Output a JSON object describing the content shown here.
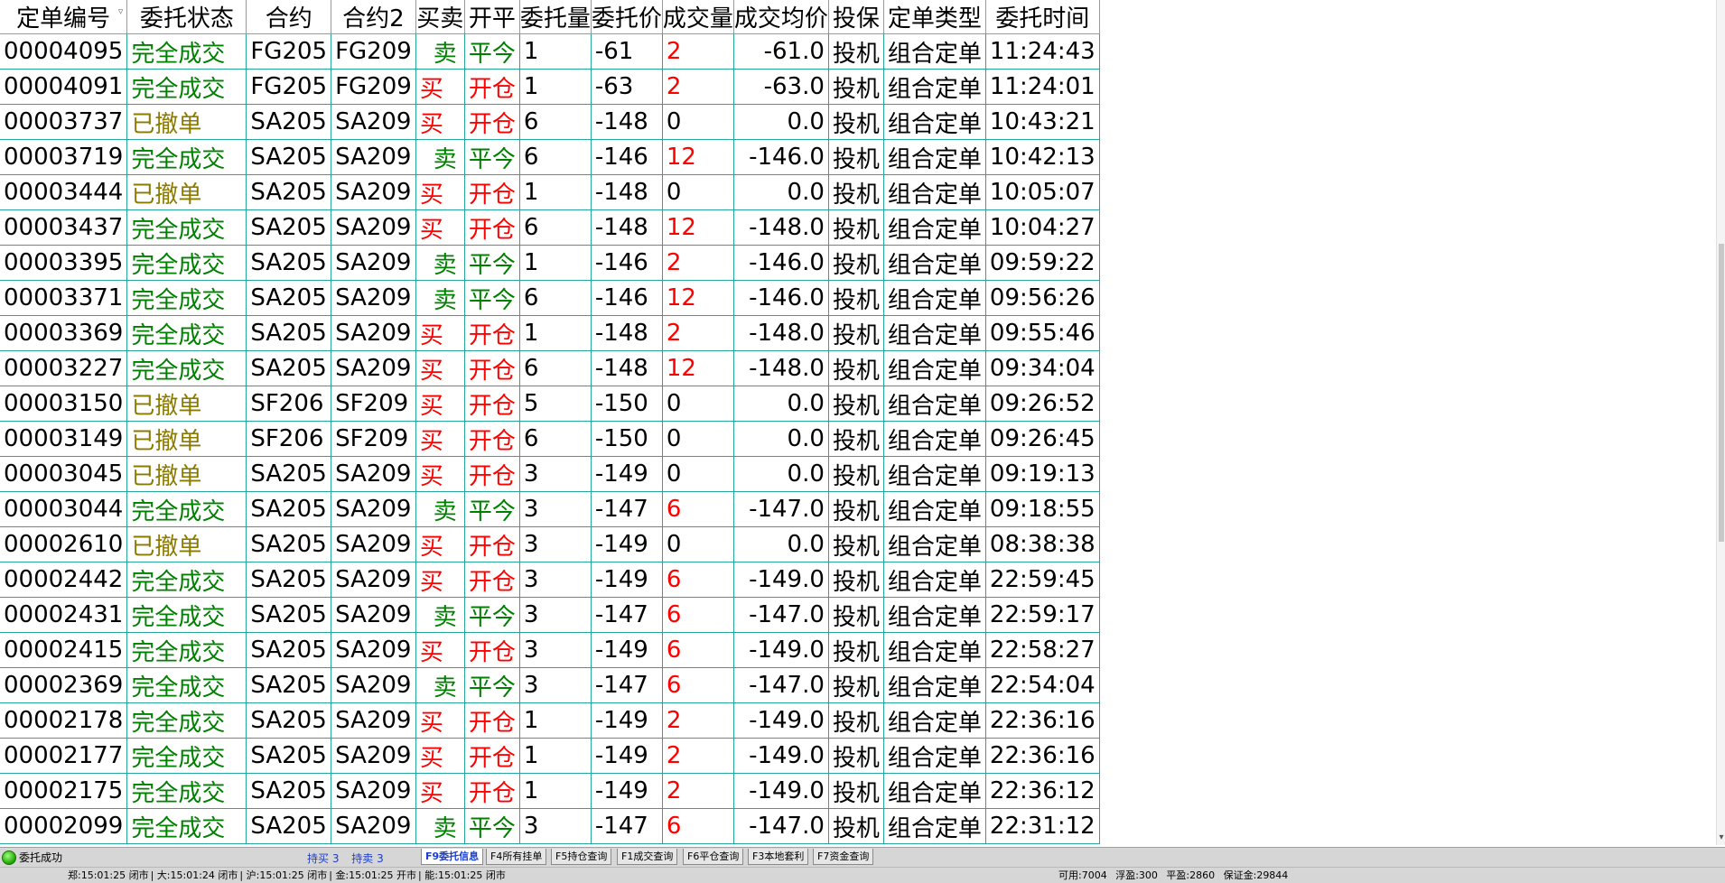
{
  "columns": [
    {
      "key": "id",
      "label": "定单编号"
    },
    {
      "key": "status",
      "label": "委托状态"
    },
    {
      "key": "contract",
      "label": "合约"
    },
    {
      "key": "contract2",
      "label": "合约2"
    },
    {
      "key": "side",
      "label": "买卖"
    },
    {
      "key": "oc",
      "label": "开平"
    },
    {
      "key": "qty",
      "label": "委托量"
    },
    {
      "key": "price",
      "label": "委托价"
    },
    {
      "key": "filled",
      "label": "成交量"
    },
    {
      "key": "avg",
      "label": "成交均价"
    },
    {
      "key": "hedge",
      "label": "投保"
    },
    {
      "key": "type",
      "label": "定单类型"
    },
    {
      "key": "time",
      "label": "委托时间"
    }
  ],
  "sort_indicator": "▿",
  "rows": [
    {
      "id": "00004095",
      "status": "完全成交",
      "contract": "FG205",
      "contract2": "FG209",
      "side": "卖",
      "oc": "平今",
      "qty": "1",
      "price": "-61",
      "filled": "2",
      "avg": "-61.0",
      "hedge": "投机",
      "type": "组合定单",
      "time": "11:24:43"
    },
    {
      "id": "00004091",
      "status": "完全成交",
      "contract": "FG205",
      "contract2": "FG209",
      "side": "买",
      "oc": "开仓",
      "qty": "1",
      "price": "-63",
      "filled": "2",
      "avg": "-63.0",
      "hedge": "投机",
      "type": "组合定单",
      "time": "11:24:01"
    },
    {
      "id": "00003737",
      "status": "已撤单",
      "contract": "SA205",
      "contract2": "SA209",
      "side": "买",
      "oc": "开仓",
      "qty": "6",
      "price": "-148",
      "filled": "0",
      "avg": "0.0",
      "hedge": "投机",
      "type": "组合定单",
      "time": "10:43:21"
    },
    {
      "id": "00003719",
      "status": "完全成交",
      "contract": "SA205",
      "contract2": "SA209",
      "side": "卖",
      "oc": "平今",
      "qty": "6",
      "price": "-146",
      "filled": "12",
      "avg": "-146.0",
      "hedge": "投机",
      "type": "组合定单",
      "time": "10:42:13"
    },
    {
      "id": "00003444",
      "status": "已撤单",
      "contract": "SA205",
      "contract2": "SA209",
      "side": "买",
      "oc": "开仓",
      "qty": "1",
      "price": "-148",
      "filled": "0",
      "avg": "0.0",
      "hedge": "投机",
      "type": "组合定单",
      "time": "10:05:07"
    },
    {
      "id": "00003437",
      "status": "完全成交",
      "contract": "SA205",
      "contract2": "SA209",
      "side": "买",
      "oc": "开仓",
      "qty": "6",
      "price": "-148",
      "filled": "12",
      "avg": "-148.0",
      "hedge": "投机",
      "type": "组合定单",
      "time": "10:04:27"
    },
    {
      "id": "00003395",
      "status": "完全成交",
      "contract": "SA205",
      "contract2": "SA209",
      "side": "卖",
      "oc": "平今",
      "qty": "1",
      "price": "-146",
      "filled": "2",
      "avg": "-146.0",
      "hedge": "投机",
      "type": "组合定单",
      "time": "09:59:22"
    },
    {
      "id": "00003371",
      "status": "完全成交",
      "contract": "SA205",
      "contract2": "SA209",
      "side": "卖",
      "oc": "平今",
      "qty": "6",
      "price": "-146",
      "filled": "12",
      "avg": "-146.0",
      "hedge": "投机",
      "type": "组合定单",
      "time": "09:56:26"
    },
    {
      "id": "00003369",
      "status": "完全成交",
      "contract": "SA205",
      "contract2": "SA209",
      "side": "买",
      "oc": "开仓",
      "qty": "1",
      "price": "-148",
      "filled": "2",
      "avg": "-148.0",
      "hedge": "投机",
      "type": "组合定单",
      "time": "09:55:46"
    },
    {
      "id": "00003227",
      "status": "完全成交",
      "contract": "SA205",
      "contract2": "SA209",
      "side": "买",
      "oc": "开仓",
      "qty": "6",
      "price": "-148",
      "filled": "12",
      "avg": "-148.0",
      "hedge": "投机",
      "type": "组合定单",
      "time": "09:34:04"
    },
    {
      "id": "00003150",
      "status": "已撤单",
      "contract": "SF206",
      "contract2": "SF209",
      "side": "买",
      "oc": "开仓",
      "qty": "5",
      "price": "-150",
      "filled": "0",
      "avg": "0.0",
      "hedge": "投机",
      "type": "组合定单",
      "time": "09:26:52"
    },
    {
      "id": "00003149",
      "status": "已撤单",
      "contract": "SF206",
      "contract2": "SF209",
      "side": "买",
      "oc": "开仓",
      "qty": "6",
      "price": "-150",
      "filled": "0",
      "avg": "0.0",
      "hedge": "投机",
      "type": "组合定单",
      "time": "09:26:45"
    },
    {
      "id": "00003045",
      "status": "已撤单",
      "contract": "SA205",
      "contract2": "SA209",
      "side": "买",
      "oc": "开仓",
      "qty": "3",
      "price": "-149",
      "filled": "0",
      "avg": "0.0",
      "hedge": "投机",
      "type": "组合定单",
      "time": "09:19:13"
    },
    {
      "id": "00003044",
      "status": "完全成交",
      "contract": "SA205",
      "contract2": "SA209",
      "side": "卖",
      "oc": "平今",
      "qty": "3",
      "price": "-147",
      "filled": "6",
      "avg": "-147.0",
      "hedge": "投机",
      "type": "组合定单",
      "time": "09:18:55"
    },
    {
      "id": "00002610",
      "status": "已撤单",
      "contract": "SA205",
      "contract2": "SA209",
      "side": "买",
      "oc": "开仓",
      "qty": "3",
      "price": "-149",
      "filled": "0",
      "avg": "0.0",
      "hedge": "投机",
      "type": "组合定单",
      "time": "08:38:38"
    },
    {
      "id": "00002442",
      "status": "完全成交",
      "contract": "SA205",
      "contract2": "SA209",
      "side": "买",
      "oc": "开仓",
      "qty": "3",
      "price": "-149",
      "filled": "6",
      "avg": "-149.0",
      "hedge": "投机",
      "type": "组合定单",
      "time": "22:59:45"
    },
    {
      "id": "00002431",
      "status": "完全成交",
      "contract": "SA205",
      "contract2": "SA209",
      "side": "卖",
      "oc": "平今",
      "qty": "3",
      "price": "-147",
      "filled": "6",
      "avg": "-147.0",
      "hedge": "投机",
      "type": "组合定单",
      "time": "22:59:17"
    },
    {
      "id": "00002415",
      "status": "完全成交",
      "contract": "SA205",
      "contract2": "SA209",
      "side": "买",
      "oc": "开仓",
      "qty": "3",
      "price": "-149",
      "filled": "6",
      "avg": "-149.0",
      "hedge": "投机",
      "type": "组合定单",
      "time": "22:58:27"
    },
    {
      "id": "00002369",
      "status": "完全成交",
      "contract": "SA205",
      "contract2": "SA209",
      "side": "卖",
      "oc": "平今",
      "qty": "3",
      "price": "-147",
      "filled": "6",
      "avg": "-147.0",
      "hedge": "投机",
      "type": "组合定单",
      "time": "22:54:04"
    },
    {
      "id": "00002178",
      "status": "完全成交",
      "contract": "SA205",
      "contract2": "SA209",
      "side": "买",
      "oc": "开仓",
      "qty": "1",
      "price": "-149",
      "filled": "2",
      "avg": "-149.0",
      "hedge": "投机",
      "type": "组合定单",
      "time": "22:36:16"
    },
    {
      "id": "00002177",
      "status": "完全成交",
      "contract": "SA205",
      "contract2": "SA209",
      "side": "买",
      "oc": "开仓",
      "qty": "1",
      "price": "-149",
      "filled": "2",
      "avg": "-149.0",
      "hedge": "投机",
      "type": "组合定单",
      "time": "22:36:16"
    },
    {
      "id": "00002175",
      "status": "完全成交",
      "contract": "SA205",
      "contract2": "SA209",
      "side": "买",
      "oc": "开仓",
      "qty": "1",
      "price": "-149",
      "filled": "2",
      "avg": "-149.0",
      "hedge": "投机",
      "type": "组合定单",
      "time": "22:36:12"
    },
    {
      "id": "00002099",
      "status": "完全成交",
      "contract": "SA205",
      "contract2": "SA209",
      "side": "卖",
      "oc": "平今",
      "qty": "3",
      "price": "-147",
      "filled": "6",
      "avg": "-147.0",
      "hedge": "投机",
      "type": "组合定单",
      "time": "22:31:12"
    }
  ],
  "statusbar": {
    "message": "委托成功",
    "buy_hold": "持买 3",
    "sell_hold": "持卖 3",
    "tabs": [
      "F9委托信息",
      "F4所有挂单",
      "F5持仓查询",
      "F1成交查询",
      "F6平仓查询",
      "F3本地套利",
      "F7资金查询"
    ],
    "active_tab": 0
  },
  "infobar": {
    "zheng": "郑:15:01:25 闭市",
    "da": "大:15:01:24 闭市",
    "hu": "沪:15:01:25 闭市",
    "jin": "金:15:01:25 开市",
    "neng": "能:15:01:25 闭市",
    "available": "可用:7004",
    "floating": "浮盈:300",
    "closed": "平盈:2860",
    "margin": "保证金:29844"
  },
  "colors": {
    "grid_line": "#27a6a0",
    "buy": "#ff0000",
    "sell": "#008000",
    "status_done": "#008000",
    "status_cancelled": "#8b7a00",
    "tab_active_text": "#1b3dd0"
  }
}
